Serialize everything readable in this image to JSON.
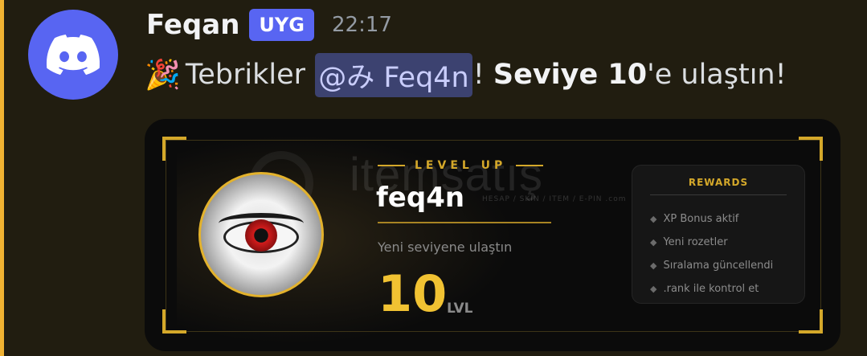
{
  "message": {
    "username": "Feqan",
    "tag": "UYG",
    "timestamp": "22:17",
    "content": {
      "emoji": "🎉",
      "prefix": "Tebrikler",
      "mention": "@み Feq4n",
      "exclaim": "!",
      "bold": "Seviye 10",
      "suffix": "'e ulaştın!"
    },
    "avatar_icon": "discord-logo-icon"
  },
  "card": {
    "watermark": "itemsatış",
    "watermark_sub": "HESAP / SKIN / ITEM / E-PIN .com",
    "title": "LEVEL UP",
    "username": "feq4n",
    "subtitle": "Yeni seviyene ulaştın",
    "level": "10",
    "level_unit": "LVL",
    "rewards": {
      "title": "REWARDS",
      "items": [
        {
          "text": "XP Bonus aktif"
        },
        {
          "text": "Yeni rozetler"
        },
        {
          "text": "Sıralama güncellendi"
        },
        {
          "text": ".rank ile kontrol et"
        }
      ]
    }
  },
  "colors": {
    "mention_bar": "#f0b232",
    "blurple": "#5865f2",
    "gold": "#d4a82a",
    "level_gold": "#f1c232"
  }
}
